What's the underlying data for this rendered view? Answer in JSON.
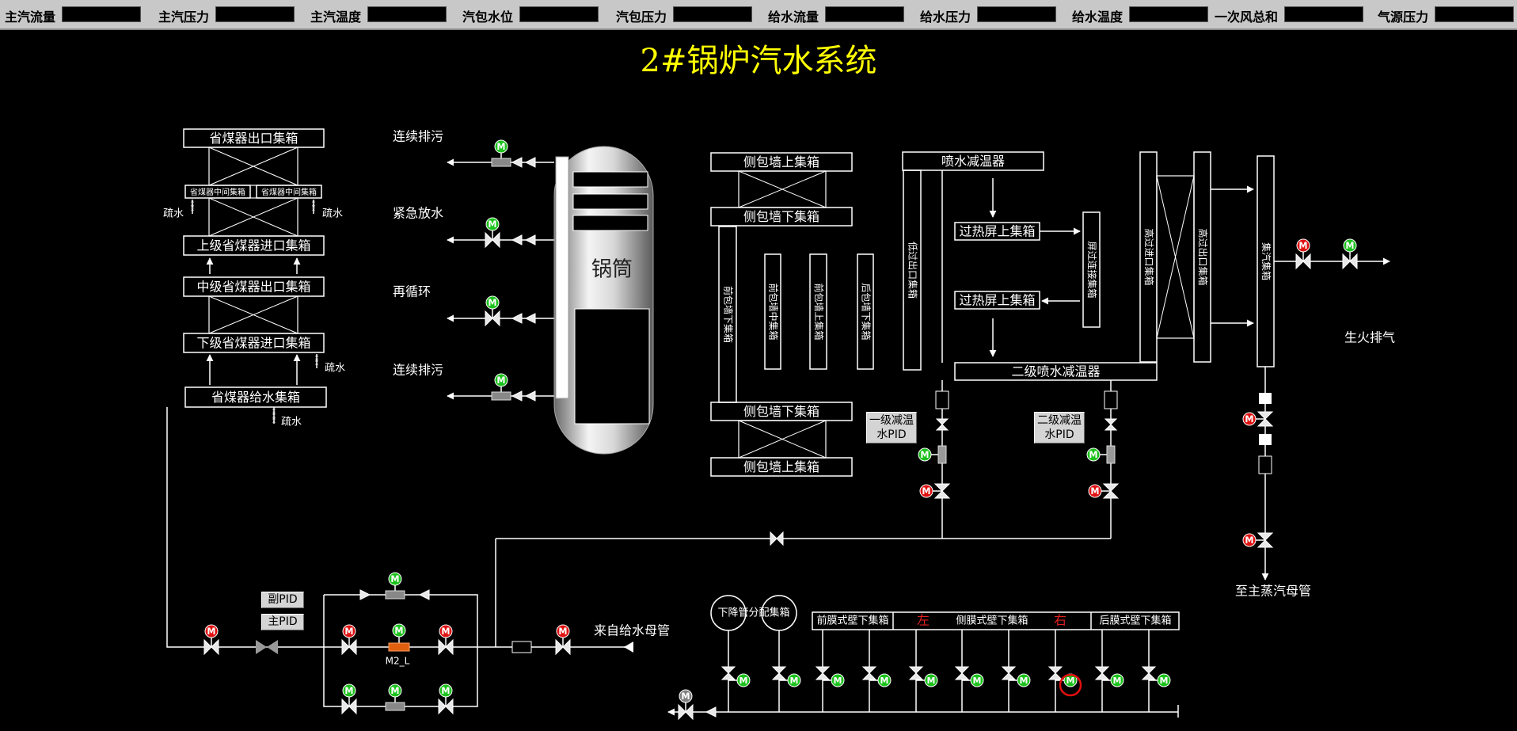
{
  "topbar": {
    "items": [
      {
        "label": "主汽流量",
        "value": ""
      },
      {
        "label": "主汽压力",
        "value": ""
      },
      {
        "label": "主汽温度",
        "value": ""
      },
      {
        "label": "汽包水位",
        "value": ""
      },
      {
        "label": "汽包压力",
        "value": ""
      },
      {
        "label": "给水流量",
        "value": ""
      },
      {
        "label": "给水压力",
        "value": ""
      },
      {
        "label": "给水温度",
        "value": ""
      },
      {
        "label": "一次风总和",
        "value": ""
      },
      {
        "label": "气源压力",
        "value": ""
      }
    ]
  },
  "title": "2#锅炉汽水系统",
  "drum": {
    "label": "锅筒"
  },
  "economizer": {
    "outlet_header": "省煤器出口集箱",
    "mid_header_left": "省煤器中间集箱",
    "mid_header_right": "省煤器中间集箱",
    "upper_inlet": "上级省煤器进口集箱",
    "mid_outlet": "中级省煤器出口集箱",
    "lower_inlet": "下级省煤器进口集箱",
    "feed_header": "省煤器给水集箱",
    "drain": "疏水"
  },
  "drum_lines": {
    "continuous_blowdown_top": "连续排污",
    "emergency_drain": "紧急放水",
    "recirculation": "再循环",
    "continuous_blowdown_bottom": "连续排污"
  },
  "walls": {
    "side_upper_top": "侧包墙上集箱",
    "side_lower_top": "侧包墙下集箱",
    "front_lower": "前包墙下集箱",
    "front_mid": "前包墙中集箱",
    "front_upper": "前包墙上集箱",
    "rear_lower": "后包墙下集箱",
    "side_lower_bottom": "侧包墙下集箱",
    "side_upper_bottom": "侧包墙上集箱"
  },
  "superheater": {
    "attemperator1": "喷水减温器",
    "lt_outlet": "低过出口集箱",
    "screen_upper_1": "过热屏上集箱",
    "screen_upper_2": "过热屏上集箱",
    "screen_connect": "屏过连接集箱",
    "attemperator2": "二级喷水减温器",
    "ht_inlet": "高过进口集箱",
    "ht_outlet": "高过出口集箱",
    "steam_collector": "集汽集箱"
  },
  "pid_boxes": {
    "first": "一级减温水PID",
    "second": "二级减温水PID"
  },
  "right_labels": {
    "startup_vent": "生火排气",
    "to_main_steam": "至主蒸汽母管"
  },
  "feedwater": {
    "from_main": "来自给水母管",
    "aux_pid": "副PID",
    "main_pid": "主PID",
    "valve_tag": "M2_L"
  },
  "bottom": {
    "downcomer": "下降管分配集箱",
    "front_wall": "前膜式壁下集箱",
    "left": "左",
    "side_wall": "侧膜式壁下集箱",
    "right": "右",
    "rear_wall": "后膜式壁下集箱"
  },
  "colors": {
    "motor_running": "#1cc21c",
    "motor_stopped": "#e01010",
    "motor_unknown": "#808080",
    "title": "#ffff00",
    "line": "#ffffff"
  },
  "motors": [
    {
      "id": "drum-blowdown-top",
      "state": "running"
    },
    {
      "id": "drum-emergency-drain",
      "state": "running"
    },
    {
      "id": "drum-recirculation",
      "state": "running"
    },
    {
      "id": "drum-blowdown-bottom",
      "state": "running"
    },
    {
      "id": "startup-vent-1",
      "state": "stopped"
    },
    {
      "id": "startup-vent-2",
      "state": "running"
    },
    {
      "id": "main-steam-1",
      "state": "stopped"
    },
    {
      "id": "main-steam-2",
      "state": "stopped"
    },
    {
      "id": "attemp1-reg",
      "state": "running"
    },
    {
      "id": "attemp1-shutoff",
      "state": "stopped"
    },
    {
      "id": "attemp2-reg",
      "state": "running"
    },
    {
      "id": "attemp2-shutoff",
      "state": "stopped"
    },
    {
      "id": "feed-main-left",
      "state": "stopped"
    },
    {
      "id": "feed-bypass-1",
      "state": "stopped"
    },
    {
      "id": "feed-reg-main",
      "state": "running"
    },
    {
      "id": "feed-bypass-2",
      "state": "stopped"
    },
    {
      "id": "feed-top-reg",
      "state": "running"
    },
    {
      "id": "feed-low-1",
      "state": "running"
    },
    {
      "id": "feed-low-reg",
      "state": "running"
    },
    {
      "id": "feed-low-2",
      "state": "running"
    },
    {
      "id": "feed-inlet",
      "state": "stopped"
    },
    {
      "id": "bottom-drain-main",
      "state": "unknown"
    }
  ]
}
